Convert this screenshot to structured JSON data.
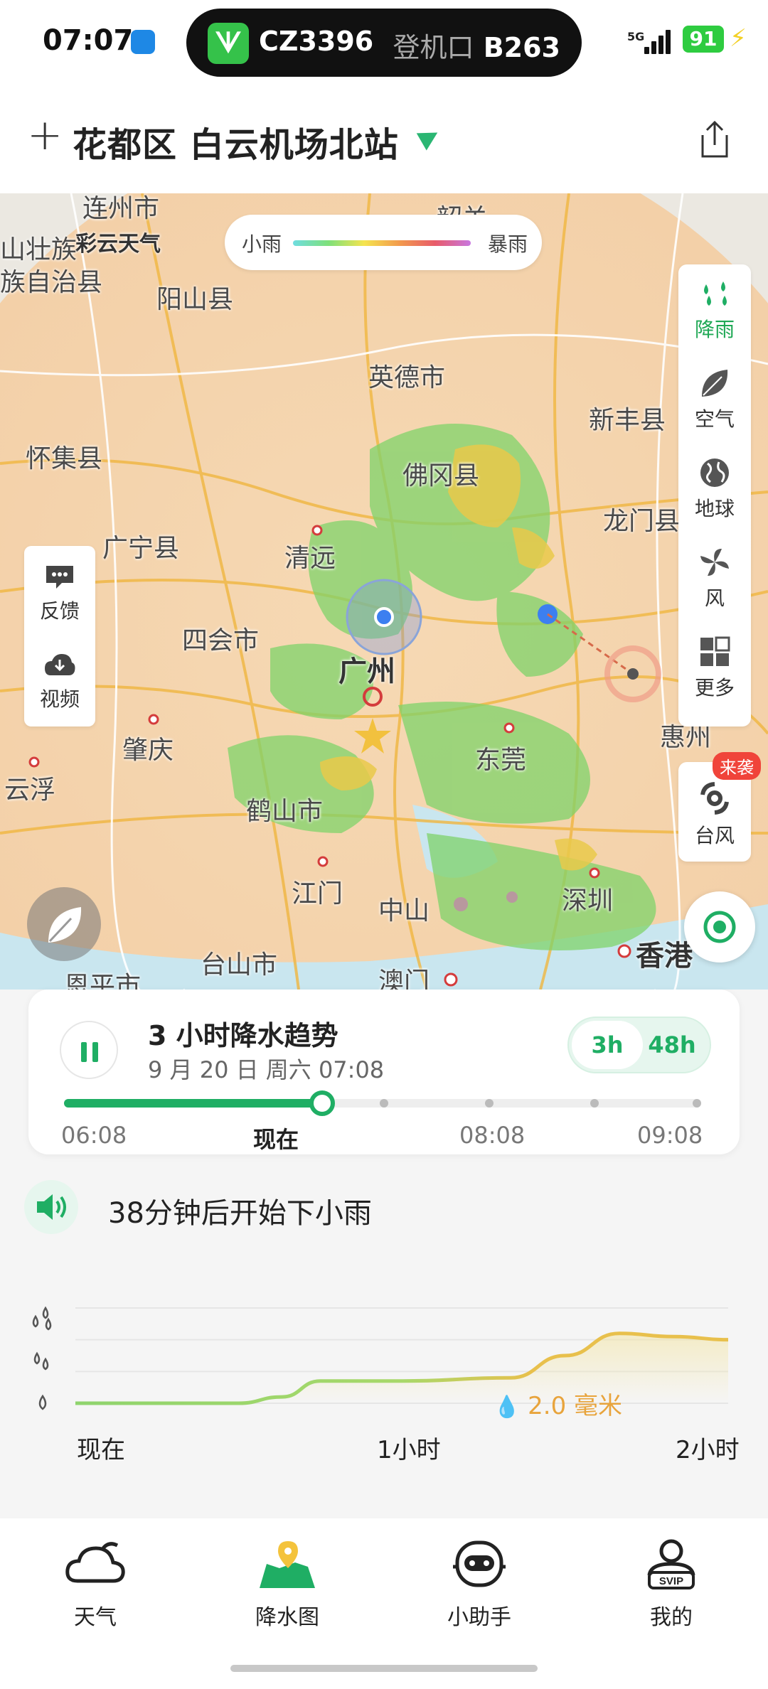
{
  "status_bar": {
    "time": "07:07",
    "flight": "CZ3396",
    "gate_label": "登机口",
    "gate": "B263",
    "network": "5G",
    "battery": "91"
  },
  "header": {
    "add_icon": "plus-icon",
    "location": "花都区 白云机场北站",
    "share_icon": "share-icon"
  },
  "map": {
    "legend": {
      "low": "小雨",
      "high": "暴雨"
    },
    "places": [
      "连州市",
      "韶关",
      "彩云天气",
      "山壮族",
      "族自治县",
      "阳山县",
      "英德市",
      "新丰县",
      "怀集县",
      "佛冈县",
      "龙门县",
      "广宁县",
      "清远",
      "四会市",
      "广州",
      "惠州",
      "肇庆",
      "东莞",
      "云浮",
      "鹤山市",
      "江门",
      "中山",
      "深圳",
      "香港",
      "台山市",
      "恩平市",
      "澳门"
    ],
    "left_panel": [
      {
        "icon": "feedback-icon",
        "label": "反馈"
      },
      {
        "icon": "download-video-icon",
        "label": "视频"
      }
    ],
    "right_panel": [
      {
        "icon": "rain-drops-icon",
        "label": "降雨",
        "active": true
      },
      {
        "icon": "leaf-icon",
        "label": "空气"
      },
      {
        "icon": "globe-icon",
        "label": "地球"
      },
      {
        "icon": "wind-icon",
        "label": "风"
      },
      {
        "icon": "grid-icon",
        "label": "更多"
      }
    ],
    "typhoon": {
      "label": "台风",
      "badge": "来袭"
    }
  },
  "forecast_card": {
    "title": "3 小时降水趋势",
    "date": "9 月 20 日 周六 07:08",
    "toggle": [
      "3h",
      "48h"
    ],
    "selected": "3h",
    "progress": 0.405,
    "ticks": [
      "06:08",
      "现在",
      "08:08",
      "09:08"
    ]
  },
  "alert": {
    "icon": "speaker-icon",
    "text": "38分钟后开始下小雨"
  },
  "rain_chart": {
    "x_labels": [
      "现在",
      "1小时",
      "2小时"
    ],
    "value_label": "2.0 毫米",
    "y_icons": [
      "heavy-rain-drops-icon",
      "medium-rain-drops-icon",
      "light-rain-drop-icon"
    ],
    "colors": {
      "light": "#8fd46d",
      "heavy": "#e8c04c"
    }
  },
  "chart_data": {
    "type": "area",
    "x": [
      0,
      10,
      20,
      30,
      38,
      45,
      60,
      80,
      90,
      100,
      110,
      120
    ],
    "values": [
      0,
      0,
      0,
      0,
      0.2,
      0.7,
      0.7,
      0.8,
      1.5,
      2.2,
      2.1,
      2.0
    ],
    "xlabel": "",
    "ylabel": "",
    "ylim": [
      0,
      3
    ],
    "grid": true
  },
  "bottom_nav": [
    {
      "icon": "cloud-icon",
      "label": "天气"
    },
    {
      "icon": "rain-map-icon",
      "label": "降水图",
      "active": true
    },
    {
      "icon": "assistant-icon",
      "label": "小助手"
    },
    {
      "icon": "profile-svip-icon",
      "label": "我的"
    }
  ],
  "nav_badge": "SVIP"
}
